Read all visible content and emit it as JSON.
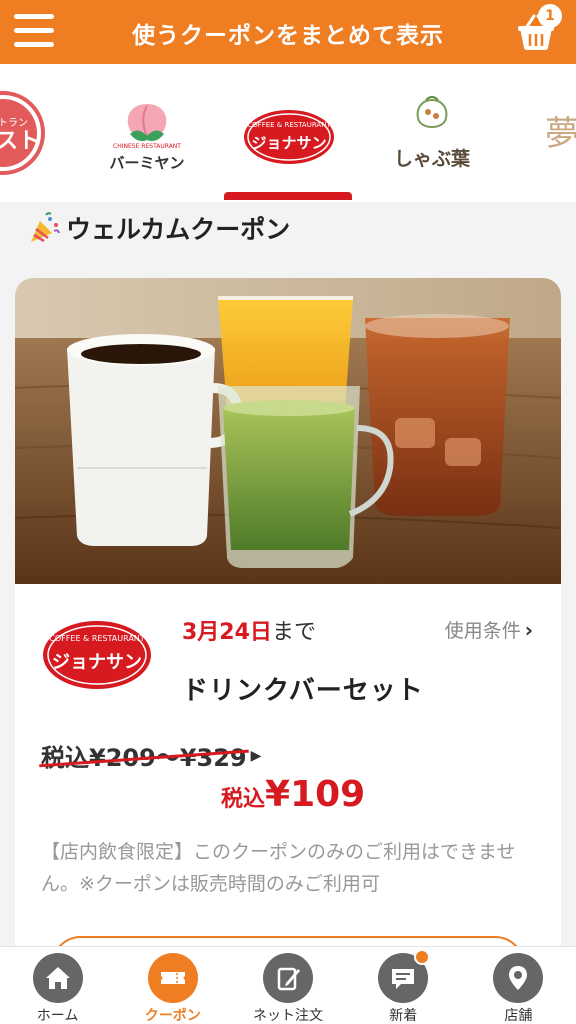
{
  "header": {
    "title": "使うクーポンをまとめて表示",
    "cart_count": "1",
    "bg_color": "#ef7d22"
  },
  "brands": [
    {
      "name": "ステーキガスト(partial)",
      "text": "スト",
      "icon": "gusto-logo"
    },
    {
      "name": "バーミヤン",
      "caption": "バーミヤン",
      "sub": "CHINESE RESTAURANT",
      "icon": "peach-logo"
    },
    {
      "name": "ジョナサン",
      "caption": "ジョナサン",
      "sub": "COFFEE & RESTAURANT",
      "icon": "jonathan-logo",
      "selected": true
    },
    {
      "name": "しゃぶ葉",
      "caption": "しゃぶ葉",
      "icon": "shabuyo-logo"
    },
    {
      "name": "夢庵(partial)",
      "caption": "夢",
      "icon": "yumean-logo"
    }
  ],
  "section": {
    "title": "ウェルカムクーポン",
    "icon": "party-popper-icon"
  },
  "coupon": {
    "expiry_date": "3月24日",
    "expiry_suffix": "まで",
    "conditions_label": "使用条件",
    "name": "ドリンクバーセット",
    "original_price": "税込¥209〜¥329",
    "new_price_label": "税込",
    "new_price": "¥109",
    "note": "【店内飲食限定】このクーポンのみのご利用はできません。※クーポンは販売時間のみご利用可",
    "brand_logo_text": "ジョナサン",
    "brand_logo_sub": "COFFEE & RESTAURANT"
  },
  "nav": [
    {
      "label": "ホーム",
      "icon": "home-icon"
    },
    {
      "label": "クーポン",
      "icon": "coupon-icon",
      "active": true
    },
    {
      "label": "ネット注文",
      "icon": "pencil-icon"
    },
    {
      "label": "新着",
      "icon": "message-icon",
      "has_dot": true
    },
    {
      "label": "店舗",
      "icon": "map-pin-icon"
    }
  ],
  "colors": {
    "accent": "#ef7d22",
    "red": "#d71920"
  }
}
